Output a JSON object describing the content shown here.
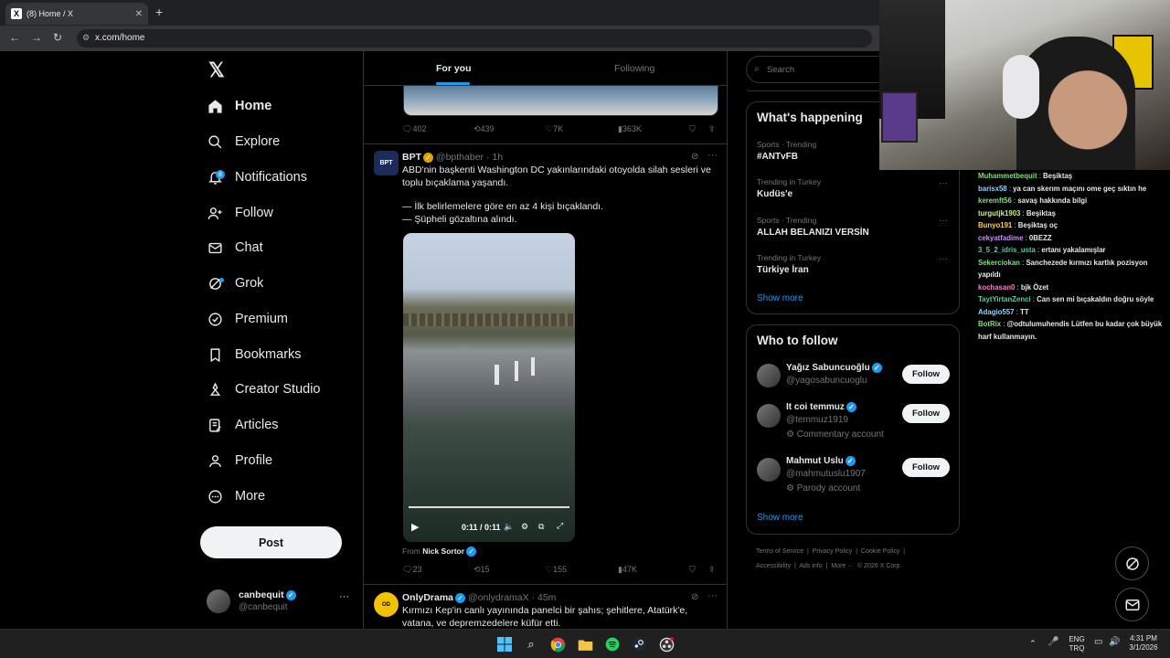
{
  "browser": {
    "tab_title": "(8) Home / X",
    "url": "x.com/home"
  },
  "nav": {
    "items": [
      {
        "label": "Home",
        "badge": ""
      },
      {
        "label": "Explore",
        "badge": ""
      },
      {
        "label": "Notifications",
        "badge": "8"
      },
      {
        "label": "Follow",
        "badge": ""
      },
      {
        "label": "Chat",
        "badge": ""
      },
      {
        "label": "Grok",
        "badge": ""
      },
      {
        "label": "Premium",
        "badge": ""
      },
      {
        "label": "Bookmarks",
        "badge": ""
      },
      {
        "label": "Creator Studio",
        "badge": ""
      },
      {
        "label": "Articles",
        "badge": ""
      },
      {
        "label": "Profile",
        "badge": ""
      },
      {
        "label": "More",
        "badge": ""
      }
    ],
    "post_label": "Post",
    "account": {
      "name": "canbequit",
      "handle": "@canbequit"
    }
  },
  "feed": {
    "tabs": [
      "For you",
      "Following"
    ],
    "prev_tweet_stats": {
      "replies": "402",
      "reposts": "439",
      "likes": "7K",
      "views": "363K"
    },
    "tweet1": {
      "name": "BPT",
      "handle": "@bpthaber",
      "time": "· 1h",
      "line1": "ABD'nin başkenti Washington DC yakınlarındaki otoyolda silah sesleri ve toplu bıçaklama yaşandı.",
      "line2": "— İlk belirlemelere göre en az 4 kişi bıçaklandı.",
      "line3": "— Şüpheli gözaltına alındı.",
      "video_time": "0:11 / 0:11",
      "from_prefix": "From",
      "from_name": "Nick Sortor",
      "stats": {
        "replies": "23",
        "reposts": "15",
        "likes": "155",
        "views": "47K"
      }
    },
    "tweet2": {
      "name": "OnlyDrama",
      "handle": "@onlydramaX",
      "time": "· 45m",
      "text": "Kırmızı Kep'in canlı yayınında panelci bir şahıs; şehitlere, Atatürk'e, vatana, ve depremzedelere küfür etti."
    }
  },
  "sidebar": {
    "search_placeholder": "Search",
    "trends_title": "What's happening",
    "trends": [
      {
        "context": "Sports · Trending",
        "name": "#ANTvFB"
      },
      {
        "context": "Trending in Turkey",
        "name": "Kudüs'e"
      },
      {
        "context": "Sports · Trending",
        "name": "ALLAH BELANIZI VERSİN"
      },
      {
        "context": "Trending in Turkey",
        "name": "Türkiye İran"
      }
    ],
    "show_more": "Show more",
    "wtf_title": "Who to follow",
    "wtf": [
      {
        "name": "Yağız Sabuncuoğlu",
        "handle": "@yagosabuncuoglu",
        "note": ""
      },
      {
        "name": "It coi temmuz",
        "handle": "@temmuz1919",
        "note": "Commentary account"
      },
      {
        "name": "Mahmut Uslu",
        "handle": "@mahmutuslu1907",
        "note": "Parody account"
      }
    ],
    "follow_label": "Follow",
    "footer": [
      "Terms of Service",
      "Privacy Policy",
      "Cookie Policy",
      "Accessibility",
      "Ads info",
      "More ···",
      "© 2026 X Corp."
    ]
  },
  "chat": [
    {
      "user": "Muhammetbequit",
      "msg": "Beşiktaş",
      "color": "#7fe07f"
    },
    {
      "user": "barisx58",
      "msg": "ya can skerım maçını ome geç sıktın he",
      "color": "#8fd3ff"
    },
    {
      "user": "keremft56",
      "msg": "savaş hakkında bilgi",
      "color": "#7fe07f"
    },
    {
      "user": "turgutjk1903",
      "msg": "Beşiktaş",
      "color": "#c7f27f"
    },
    {
      "user": "Bunyo191",
      "msg": "Beşiktaş oç",
      "color": "#ffd24a"
    },
    {
      "user": "cekyatfadime",
      "msg": "0BEZZ",
      "color": "#c48bff"
    },
    {
      "user": "3_5_2_idris_usta",
      "msg": "ertanı yakalamışlar",
      "color": "#4fd1a5"
    },
    {
      "user": "Sekerciokan",
      "msg": "Sanchezede kırmızı kartlık pozisyon yapıldı",
      "color": "#7fe07f"
    },
    {
      "user": "kochasan0",
      "msg": "bjk Özet",
      "color": "#ff7bd5"
    },
    {
      "user": "TaytYirtanZenci",
      "msg": "Can sen mi bıçakaldın doğru söyle",
      "color": "#4fd1a5"
    },
    {
      "user": "Adagio557",
      "msg": "TT",
      "color": "#8fd3ff"
    },
    {
      "user": "BotRix",
      "msg": "@odtulumuhendis Lütfen bu kadar çok büyük harf kullanmayın.",
      "color": "#7fe07f"
    }
  ],
  "taskbar": {
    "lang1": "ENG",
    "lang2": "TRQ",
    "time": "4:31 PM",
    "date": "3/1/2026"
  }
}
